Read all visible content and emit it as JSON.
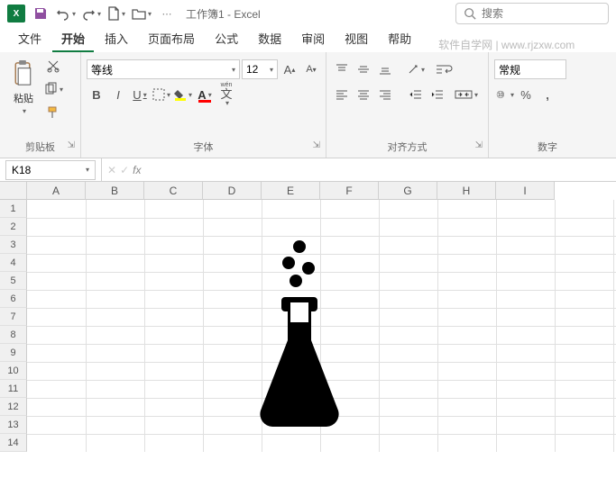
{
  "titlebar": {
    "app_icon_text": "X",
    "title": "工作簿1 - Excel",
    "search_placeholder": "搜索"
  },
  "tabs": {
    "items": [
      "文件",
      "开始",
      "插入",
      "页面布局",
      "公式",
      "数据",
      "审阅",
      "视图",
      "帮助"
    ],
    "active_index": 1,
    "watermark": "软件自学网 | www.rjzxw.com"
  },
  "ribbon": {
    "clipboard": {
      "paste": "粘贴",
      "label": "剪贴板"
    },
    "font": {
      "name": "等线",
      "size": "12",
      "label": "字体",
      "wen": "wén"
    },
    "alignment": {
      "label": "对齐方式"
    },
    "number": {
      "format": "常规",
      "label": "数字",
      "percent": "%"
    }
  },
  "namebox": {
    "cell_ref": "K18",
    "fx": "fx"
  },
  "grid": {
    "columns": [
      "A",
      "B",
      "C",
      "D",
      "E",
      "F",
      "G",
      "H",
      "I"
    ],
    "rows": [
      "1",
      "2",
      "3",
      "4",
      "5",
      "6",
      "7",
      "8",
      "9",
      "10",
      "11",
      "12",
      "13",
      "14"
    ]
  }
}
